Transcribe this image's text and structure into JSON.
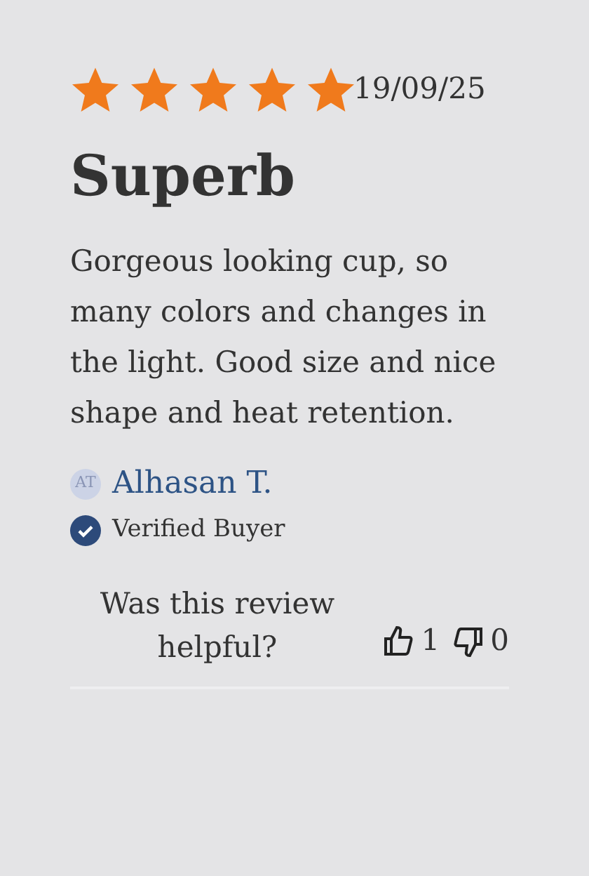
{
  "review": {
    "stars": 5,
    "date": "19/09/25",
    "title": "Superb",
    "body": "Gorgeous looking cup, so many colors and changes in the light. Good size and nice shape and heat retention.",
    "author": {
      "initials": "AT",
      "name": "Alhasan T.",
      "verified": true,
      "verified_label": "Verified Buyer"
    },
    "helpful": {
      "question": "Was this review helpful?",
      "up_count": "1",
      "down_count": "0"
    }
  }
}
